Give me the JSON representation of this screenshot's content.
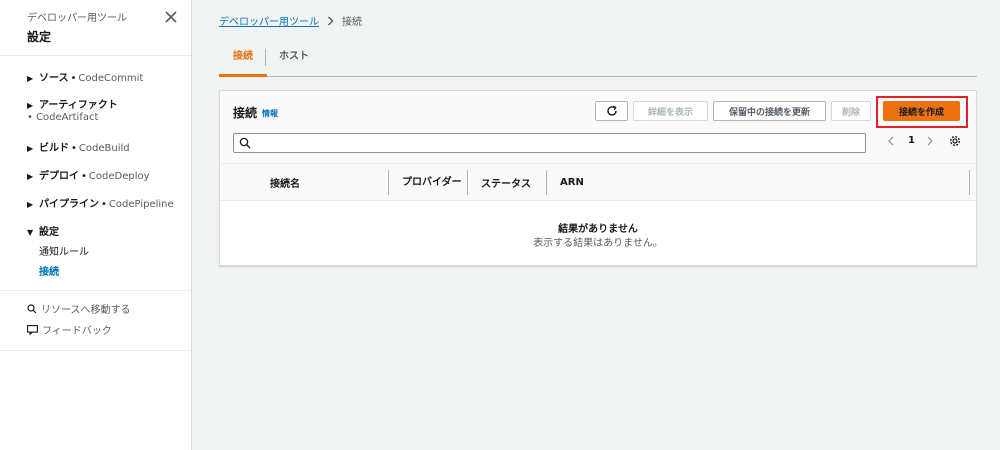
{
  "sidebar": {
    "subtitle": "デベロッパー用ツール",
    "title": "設定",
    "groups": [
      {
        "label": "ソース",
        "service": "CodeCommit"
      },
      {
        "label": "アーティファクト",
        "service": "CodeArtifact"
      },
      {
        "label": "ビルド",
        "service": "CodeBuild"
      },
      {
        "label": "デプロイ",
        "service": "CodeDeploy"
      },
      {
        "label": "パイプライン",
        "service": "CodePipeline"
      },
      {
        "label": "設定"
      }
    ],
    "settings_items": [
      "通知ルール",
      "接続"
    ],
    "utilities": {
      "goto": "リソースへ移動する",
      "feedback": "フィードバック"
    }
  },
  "breadcrumb": {
    "parent": "デベロッパー用ツール",
    "current": "接続"
  },
  "tabs": [
    "接続",
    "ホスト"
  ],
  "panel": {
    "title": "接続",
    "info": "情報",
    "buttons": {
      "details": "詳細を表示",
      "update_pending": "保留中の接続を更新",
      "delete": "削除",
      "create": "接続を作成"
    },
    "search_placeholder": "",
    "page": "1",
    "columns": [
      "接続名",
      "プロバイダー",
      "ステータス",
      "ARN"
    ],
    "empty_title": "結果がありません",
    "empty_desc": "表示する結果はありません。"
  },
  "colors": {
    "accent": "#ec7211",
    "link": "#0073bb",
    "highlight": "#e4202d"
  }
}
